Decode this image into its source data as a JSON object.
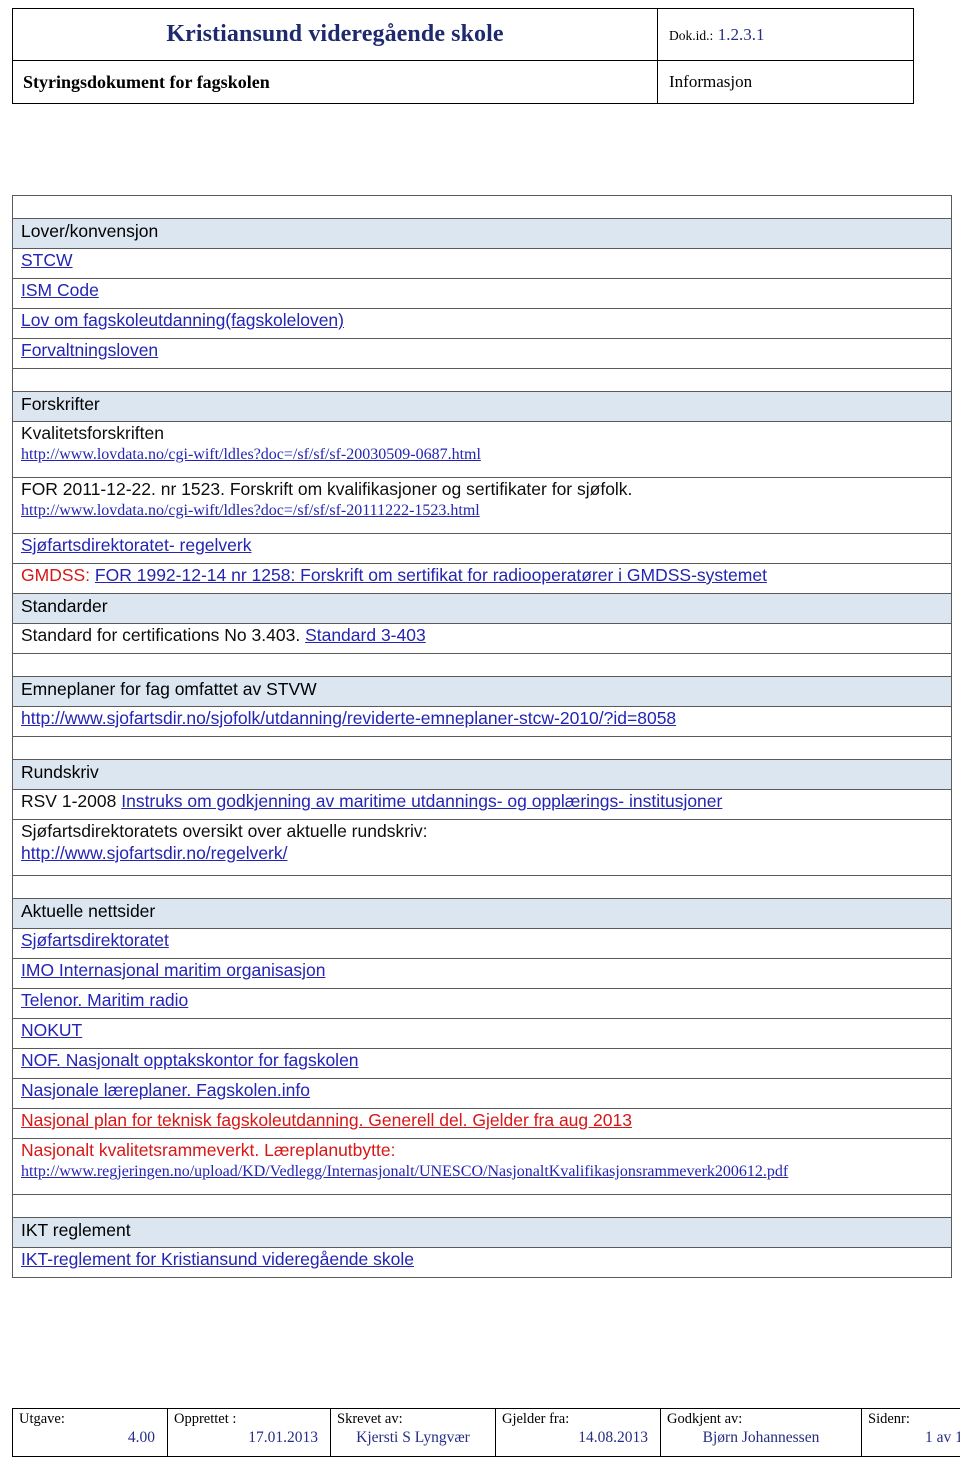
{
  "header": {
    "school_title": "Kristiansund videregående skole",
    "dokid_label": "Dok.id.:",
    "dokid_value": "1.2.3.1",
    "subtitle": "Styringsdokument for fagskolen",
    "classification": "Informasjon"
  },
  "sections": {
    "lover": {
      "heading": "Lover/konvensjon",
      "items": [
        "STCW",
        "ISM Code",
        "Lov om fagskoleutdanning(fagskoleloven)",
        "Forvaltningsloven"
      ]
    },
    "forskrifter": {
      "heading": "Forskrifter",
      "kvalitetsforskriften_label": "Kvalitetsforskriften",
      "kvalitetsforskriften_url": "http://www.lovdata.no/cgi-wift/ldles?doc=/sf/sf/sf-20030509-0687.html",
      "for_2011_text": "FOR 2011-12-22. nr 1523. Forskrift om kvalifikasjoner og sertifikater for sjøfolk.",
      "for_2011_url": "http://www.lovdata.no/cgi-wift/ldles?doc=/sf/sf/sf-20111222-1523.html",
      "sjofartsdirektoratet_regelverk": "Sjøfartsdirektoratet- regelverk",
      "gmdss_prefix": "GMDSS:",
      "gmdss_link": "FOR 1992-12-14 nr 1258: Forskrift om sertifikat for radiooperatører i GMDSS-systemet"
    },
    "standarder": {
      "heading": "Standarder",
      "standard_text": "Standard for certifications No 3.403.",
      "standard_link": "Standard 3-403"
    },
    "emneplaner": {
      "heading": "Emneplaner for fag omfattet av STVW",
      "url": "http://www.sjofartsdir.no/sjofolk/utdanning/reviderte-emneplaner-stcw-2010/?id=8058"
    },
    "rundskriv": {
      "heading": "Rundskriv",
      "rsv_prefix": "RSV 1-2008",
      "rsv_link": "Instruks om godkjenning av maritime utdannings- og opplærings- institusjoner",
      "oversikt_text": "Sjøfartsdirektoratets oversikt over aktuelle rundskriv:",
      "oversikt_url": "http://www.sjofartsdir.no/regelverk/"
    },
    "nettsider": {
      "heading": "Aktuelle nettsider",
      "items": [
        "Sjøfartsdirektoratet",
        "IMO Internasjonal maritim organisasjon",
        "Telenor. Maritim radio",
        "NOKUT",
        "NOF. Nasjonalt opptakskontor for fagskolen",
        "Nasjonale læreplaner. Fagskolen.info"
      ],
      "nasjonal_plan_link": "Nasjonal plan for teknisk fagskoleutdanning. Generell del. Gjelder fra aug 2013",
      "kvalitetsrammeverk_text": "Nasjonalt kvalitetsrammeverkt. Læreplanutbytte:",
      "kvalitetsrammeverk_url": "http://www.regjeringen.no/upload/KD/Vedlegg/Internasjonalt/UNESCO/NasjonaltKvalifikasjonsrammeverk200612.pdf"
    },
    "ikt": {
      "heading": "IKT reglement",
      "link": "IKT-reglement for Kristiansund videregående skole"
    }
  },
  "footer": {
    "columns": [
      {
        "label": "Utgave:",
        "value": "4.00"
      },
      {
        "label": "Opprettet :",
        "value": "17.01.2013"
      },
      {
        "label": "Skrevet av:",
        "value": "Kjersti S Lyngvær"
      },
      {
        "label": "Gjelder fra:",
        "value": "14.08.2013"
      },
      {
        "label": "Godkjent av:",
        "value": "Bjørn Johannessen"
      },
      {
        "label": "Sidenr:",
        "value": "1 av 1"
      }
    ]
  },
  "colors": {
    "brand_navy": "#1f2a6e",
    "link_blue": "#2424b5",
    "accent_red": "#d81616",
    "section_header_bg": "#dce6f1"
  }
}
